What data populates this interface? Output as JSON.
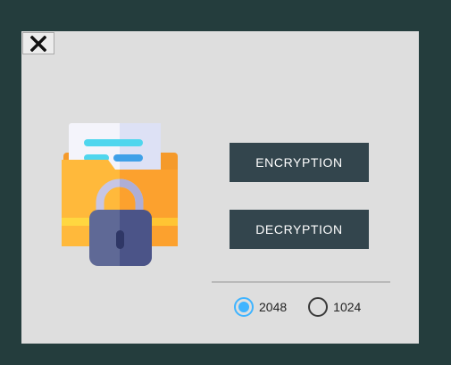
{
  "window": {
    "close_glyph": "✕",
    "background": "#dedede"
  },
  "illustration": {
    "icon": "locked-folder-icon"
  },
  "buttons": {
    "encryption_label": "ENCRYPTION",
    "decryption_label": "DECRYPTION"
  },
  "key_size": {
    "options": [
      {
        "label": "2048",
        "selected": true
      },
      {
        "label": "1024",
        "selected": false
      }
    ]
  },
  "colors": {
    "page_background": "#243d3d",
    "button_background": "#33454d",
    "radio_accent": "#3fb4ff"
  }
}
